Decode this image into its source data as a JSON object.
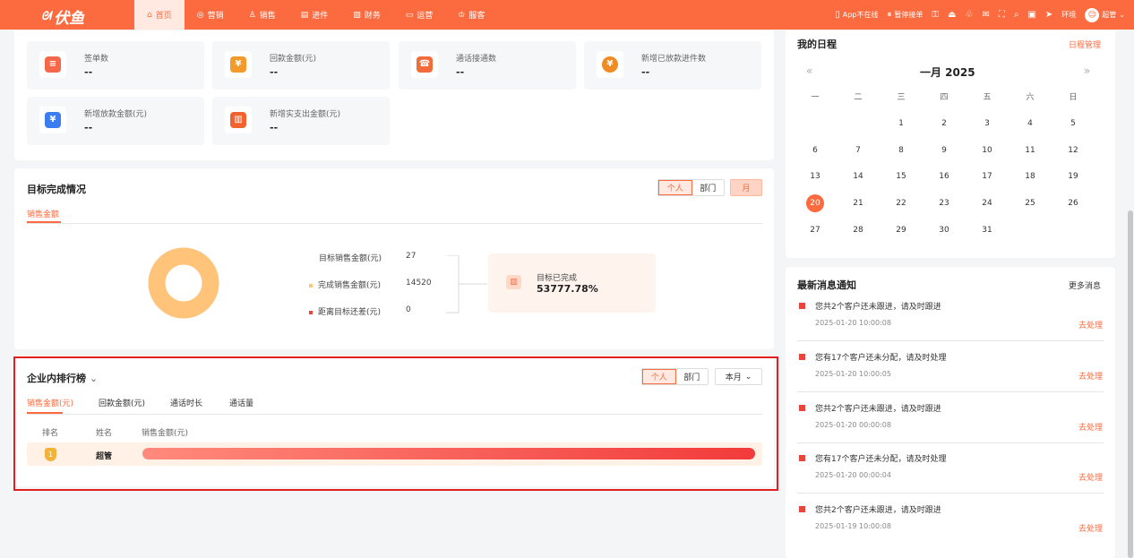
{
  "app": {
    "logo": "伏鱼"
  },
  "nav": [
    {
      "icon": "⌂",
      "label": "首页",
      "active": true
    },
    {
      "icon": "◎",
      "label": "营销"
    },
    {
      "icon": "♙",
      "label": "销售"
    },
    {
      "icon": "▤",
      "label": "进件"
    },
    {
      "icon": "▨",
      "label": "财务"
    },
    {
      "icon": "▭",
      "label": "运营"
    },
    {
      "icon": "♔",
      "label": "服客"
    }
  ],
  "tools": {
    "app_status": "App不在线",
    "pause": "暂停接单",
    "env": "环境",
    "user": "超管"
  },
  "stats": [
    {
      "label": "签单数",
      "value": "--",
      "icon": "doc-icon",
      "color": "#f5694a"
    },
    {
      "label": "回款金额(元)",
      "value": "--",
      "icon": "receipt-icon",
      "color": "#f39a2b"
    },
    {
      "label": "通话接通数",
      "value": "--",
      "icon": "phone-icon",
      "color": "#f26b3a"
    },
    {
      "label": "新增已放款进件数",
      "value": "--",
      "icon": "coin-icon",
      "color": "#f08a24"
    },
    {
      "label": "新增放款金额(元)",
      "value": "--",
      "icon": "yen-shield-icon",
      "color": "#3b7df0"
    },
    {
      "label": "新增实支出金额(元)",
      "value": "--",
      "icon": "folder-chart-icon",
      "color": "#f0632f"
    }
  ],
  "goal": {
    "title": "目标完成情况",
    "tab": "销售金额",
    "seg": [
      "个人",
      "部门"
    ],
    "period": "月",
    "rows": [
      {
        "label": "目标销售金额(元)",
        "value": "27"
      },
      {
        "label": "完成销售金额(元)",
        "value": "14520"
      },
      {
        "label": "距离目标还差(元)",
        "value": "0"
      }
    ],
    "done_label": "目标已完成",
    "done_value": "53777.78%",
    "donut_color": "#ffc47a"
  },
  "rank": {
    "title": "企业内排行榜",
    "tabs": [
      "销售金额(元)",
      "回款金额(元)",
      "通话时长",
      "通话量"
    ],
    "seg": [
      "个人",
      "部门"
    ],
    "period": "本月",
    "cols": [
      "排名",
      "姓名",
      "销售金额(元)"
    ],
    "rows": [
      {
        "name": "超管",
        "fill": 1.0
      }
    ]
  },
  "calendar": {
    "title": "我的日程",
    "manage": "日程管理",
    "month": "一月 2025",
    "weekdays": [
      "一",
      "二",
      "三",
      "四",
      "五",
      "六",
      "日"
    ],
    "days": [
      "",
      "",
      "1",
      "2",
      "3",
      "4",
      "5",
      "6",
      "7",
      "8",
      "9",
      "10",
      "11",
      "12",
      "13",
      "14",
      "15",
      "16",
      "17",
      "18",
      "19",
      "20",
      "21",
      "22",
      "23",
      "24",
      "25",
      "26",
      "27",
      "28",
      "29",
      "30",
      "31"
    ],
    "today": "20"
  },
  "messages": {
    "title": "最新消息通知",
    "more": "更多消息",
    "items": [
      {
        "text": "您共2个客户还未跟进，请及时跟进",
        "time": "2025-01-20 10:00:08",
        "action": "去处理"
      },
      {
        "text": "您有17个客户还未分配，请及时处理",
        "time": "2025-01-20 10:00:05",
        "action": "去处理"
      },
      {
        "text": "您共2个客户还未跟进，请及时跟进",
        "time": "2025-01-20 00:00:08",
        "action": "去处理"
      },
      {
        "text": "您有17个客户还未分配，请及时处理",
        "time": "2025-01-20 00:00:04",
        "action": "去处理"
      },
      {
        "text": "您共2个客户还未跟进，请及时跟进",
        "time": "2025-01-19 10:00:08",
        "action": "去处理"
      }
    ]
  },
  "highlight_color": "#e02020"
}
